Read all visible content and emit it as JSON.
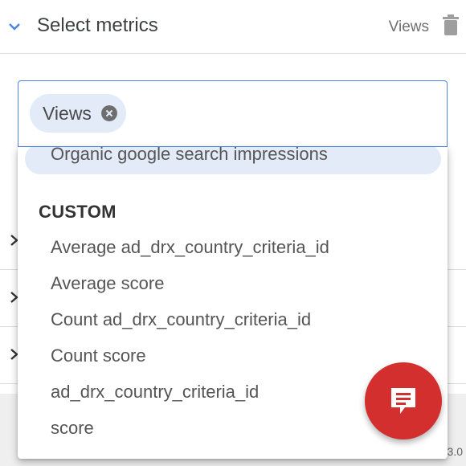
{
  "header": {
    "title": "Select metrics",
    "selected_summary": "Views",
    "icons": {
      "expand": "chevron-down-icon",
      "delete": "trash-icon"
    }
  },
  "search": {
    "chips": [
      {
        "label": "Views",
        "remove_icon": "close-circle-icon"
      }
    ]
  },
  "dropdown": {
    "highlighted_option": "Organic google search impressions",
    "groups": [
      {
        "label": "CUSTOM",
        "options": [
          "Average ad_drx_country_criteria_id",
          "Average score",
          "Count ad_drx_country_criteria_id",
          "Count score",
          "ad_drx_country_criteria_id",
          "score"
        ]
      }
    ]
  },
  "background": {
    "rows_icon": "chevron-right-icon",
    "footer_partial_text": "3.0"
  },
  "fab": {
    "icon": "feedback-icon"
  },
  "colors": {
    "accent_blue": "#4a86e8",
    "chip_bg": "#e3ebf8",
    "fab_red": "#d32f2f"
  }
}
